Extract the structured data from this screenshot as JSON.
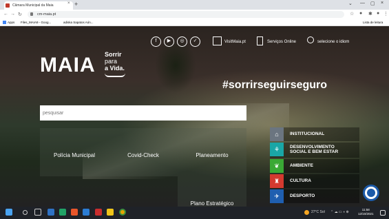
{
  "browser": {
    "tab_title": "Câmara Municipal da Maia",
    "tab_close": "×",
    "new_tab": "+",
    "address": "cm-maia.pt",
    "window_controls": [
      "⌄",
      "—",
      "▢",
      "×"
    ],
    "bookmarks": [
      "Apps",
      "Files_MAIA9 - Goog...",
      "adiska Sapatos Aón..."
    ],
    "reading_list": "Lista de leitura"
  },
  "header": {
    "social_icons": [
      "facebook-icon",
      "youtube-icon",
      "instagram-icon",
      "twitter-icon"
    ],
    "visitmaia_label": "VisitMaia.pt",
    "servicos_label": "Serviços Online",
    "idioma_label": "selecione o idiom"
  },
  "logo": {
    "wordmark": "MAIA",
    "tag_line1": "Sorrir",
    "tag_line2": "para",
    "tag_line3": "a Vida."
  },
  "hashtag": "#sorrirseguirseguro",
  "search": {
    "placeholder": "pesquisar"
  },
  "tiles": [
    "Polícia Municipal",
    "Covid-Check",
    "Planeamento",
    "Plano Estratégico"
  ],
  "menu": [
    {
      "label": "INSTITUCIONAL",
      "color": "#6b7580",
      "icon": "building-icon"
    },
    {
      "label": "DESENVOLVIMENTO SOCIAL E BEM ESTAR",
      "color": "#1aa6a6",
      "icon": "people-icon"
    },
    {
      "label": "AMBIENTE",
      "color": "#3aa935",
      "icon": "leaf-icon"
    },
    {
      "label": "CULTURA",
      "color": "#d43a2f",
      "icon": "theater-icon"
    },
    {
      "label": "DESPORTO",
      "color": "#1f5fb0",
      "icon": "runner-icon"
    }
  ],
  "taskbar": {
    "weather": "27°C Sol",
    "time": "11:58",
    "date": "12/10/2021"
  }
}
